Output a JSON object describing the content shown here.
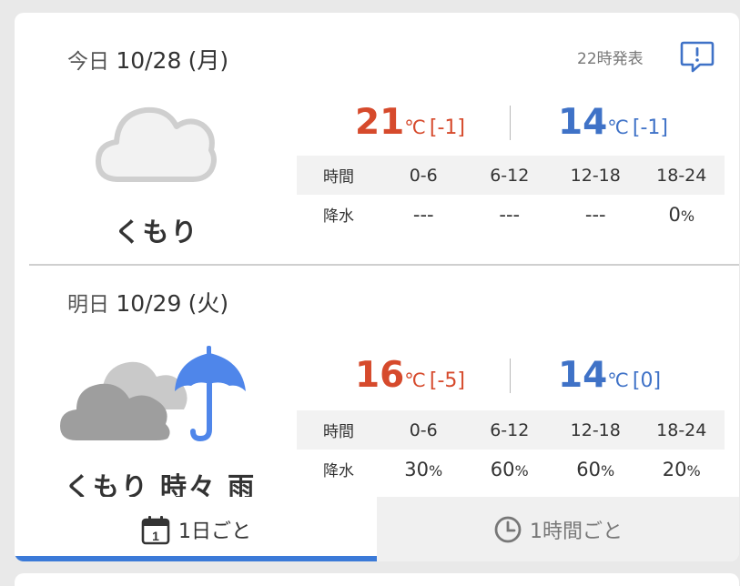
{
  "header": {
    "announcement": "22時発表",
    "report_icon": "feedback-icon"
  },
  "colors": {
    "high_temp": "#d64a2c",
    "low_temp": "#3f72c7",
    "accent": "#3b7ad8",
    "umbrella": "#4f86ea"
  },
  "days": [
    {
      "label": "今日",
      "date": "10/28",
      "weekday": "(月)",
      "icon": "cloud-icon",
      "condition": "くもり",
      "high": {
        "value": "21",
        "unit": "℃",
        "diff": "[-1]"
      },
      "low": {
        "value": "14",
        "unit": "℃",
        "diff": "[-1]"
      },
      "table": {
        "header_label": "時間",
        "periods": [
          "0-6",
          "6-12",
          "12-18",
          "18-24"
        ],
        "row_label": "降水",
        "values": [
          {
            "v": "---",
            "u": ""
          },
          {
            "v": "---",
            "u": ""
          },
          {
            "v": "---",
            "u": ""
          },
          {
            "v": "0",
            "u": "%"
          }
        ]
      }
    },
    {
      "label": "明日",
      "date": "10/29",
      "weekday": "(火)",
      "icon": "cloud-rain-umbrella-icon",
      "condition": "くもり 時々 雨",
      "high": {
        "value": "16",
        "unit": "℃",
        "diff": "[-5]"
      },
      "low": {
        "value": "14",
        "unit": "℃",
        "diff": "[0]"
      },
      "table": {
        "header_label": "時間",
        "periods": [
          "0-6",
          "6-12",
          "12-18",
          "18-24"
        ],
        "row_label": "降水",
        "values": [
          {
            "v": "30",
            "u": "%"
          },
          {
            "v": "60",
            "u": "%"
          },
          {
            "v": "60",
            "u": "%"
          },
          {
            "v": "20",
            "u": "%"
          }
        ]
      }
    }
  ],
  "tabs": [
    {
      "label": "1日ごと",
      "icon": "calendar-icon",
      "icon_text": "1",
      "active": true
    },
    {
      "label": "1時間ごと",
      "icon": "clock-icon",
      "active": false
    }
  ]
}
